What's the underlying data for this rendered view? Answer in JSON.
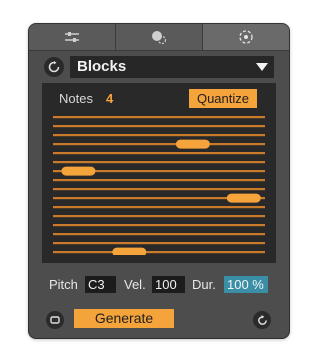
{
  "tabs": [
    {
      "icon": "sliders-icon",
      "active": false
    },
    {
      "icon": "dice-icon",
      "active": false
    },
    {
      "icon": "target-icon",
      "active": true
    }
  ],
  "mode": {
    "selected": "Blocks"
  },
  "panel": {
    "notes_label": "Notes",
    "notes_count": "4",
    "quantize_label": "Quantize",
    "lanes": 16,
    "notes": [
      {
        "lane": 3,
        "start": 0.58,
        "length": 0.16
      },
      {
        "lane": 6,
        "start": 0.04,
        "length": 0.16
      },
      {
        "lane": 9,
        "start": 0.82,
        "length": 0.16
      },
      {
        "lane": 15,
        "start": 0.28,
        "length": 0.16
      }
    ]
  },
  "params": {
    "pitch_label": "Pitch",
    "pitch_value": "C3",
    "vel_label": "Vel.",
    "vel_value": "100",
    "dur_label": "Dur.",
    "dur_value": "100 %"
  },
  "bottom": {
    "generate_label": "Generate"
  },
  "colors": {
    "accent": "#f5a33b",
    "lane": "#c97a2a",
    "highlight": "#3a8fa6",
    "background": "#4d4d4d"
  }
}
